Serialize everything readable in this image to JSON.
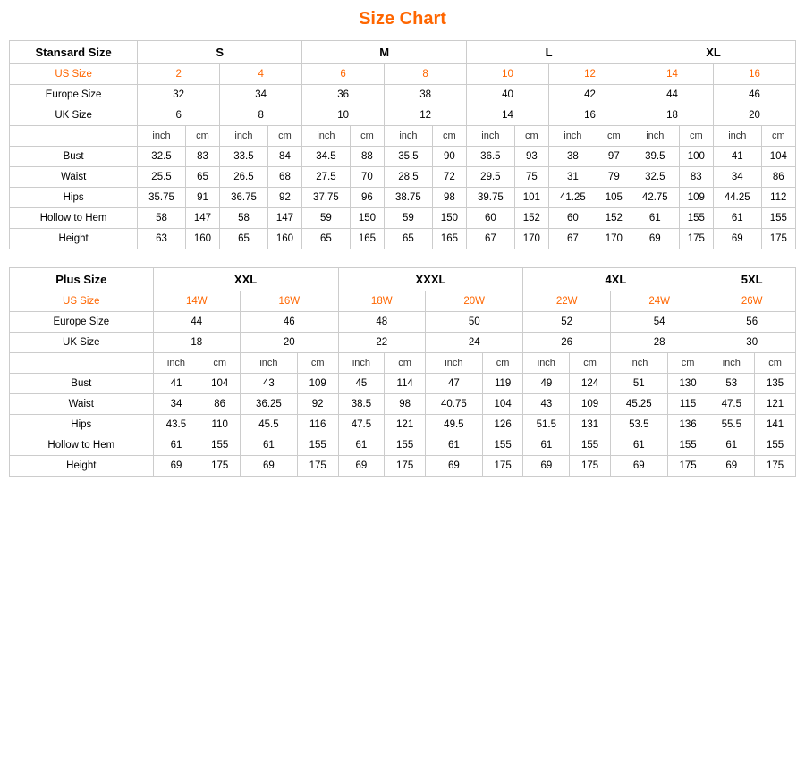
{
  "title": "Size Chart",
  "standard": {
    "headers": {
      "col1": "Stansard Size",
      "s": "S",
      "m": "M",
      "l": "L",
      "xl": "XL"
    },
    "us_size_label": "US Size",
    "us_sizes": [
      "2",
      "4",
      "6",
      "8",
      "10",
      "12",
      "14",
      "16"
    ],
    "europe_size_label": "Europe Size",
    "europe_sizes": [
      "32",
      "34",
      "36",
      "38",
      "40",
      "42",
      "44",
      "46"
    ],
    "uk_size_label": "UK Size",
    "uk_sizes": [
      "6",
      "8",
      "10",
      "12",
      "14",
      "16",
      "18",
      "20"
    ],
    "unit_inch": "inch",
    "unit_cm": "cm",
    "measurements": [
      {
        "label": "Bust",
        "values": [
          "32.5",
          "83",
          "33.5",
          "84",
          "34.5",
          "88",
          "35.5",
          "90",
          "36.5",
          "93",
          "38",
          "97",
          "39.5",
          "100",
          "41",
          "104"
        ]
      },
      {
        "label": "Waist",
        "values": [
          "25.5",
          "65",
          "26.5",
          "68",
          "27.5",
          "70",
          "28.5",
          "72",
          "29.5",
          "75",
          "31",
          "79",
          "32.5",
          "83",
          "34",
          "86"
        ]
      },
      {
        "label": "Hips",
        "values": [
          "35.75",
          "91",
          "36.75",
          "92",
          "37.75",
          "96",
          "38.75",
          "98",
          "39.75",
          "101",
          "41.25",
          "105",
          "42.75",
          "109",
          "44.25",
          "112"
        ]
      },
      {
        "label": "Hollow to Hem",
        "values": [
          "58",
          "147",
          "58",
          "147",
          "59",
          "150",
          "59",
          "150",
          "60",
          "152",
          "60",
          "152",
          "61",
          "155",
          "61",
          "155"
        ]
      },
      {
        "label": "Height",
        "values": [
          "63",
          "160",
          "65",
          "160",
          "65",
          "165",
          "65",
          "165",
          "67",
          "170",
          "67",
          "170",
          "69",
          "175",
          "69",
          "175"
        ]
      }
    ]
  },
  "plus": {
    "headers": {
      "col1": "Plus Size",
      "xxl": "XXL",
      "xxxl": "XXXL",
      "x4l": "4XL",
      "x5l": "5XL"
    },
    "us_size_label": "US Size",
    "us_sizes": [
      "14W",
      "16W",
      "18W",
      "20W",
      "22W",
      "24W",
      "26W"
    ],
    "europe_size_label": "Europe Size",
    "europe_sizes": [
      "44",
      "46",
      "48",
      "50",
      "52",
      "54",
      "56"
    ],
    "uk_size_label": "UK Size",
    "uk_sizes": [
      "18",
      "20",
      "22",
      "24",
      "26",
      "28",
      "30"
    ],
    "unit_inch": "inch",
    "unit_cm": "cm",
    "measurements": [
      {
        "label": "Bust",
        "values": [
          "41",
          "104",
          "43",
          "109",
          "45",
          "114",
          "47",
          "119",
          "49",
          "124",
          "51",
          "130",
          "53",
          "135"
        ]
      },
      {
        "label": "Waist",
        "values": [
          "34",
          "86",
          "36.25",
          "92",
          "38.5",
          "98",
          "40.75",
          "104",
          "43",
          "109",
          "45.25",
          "115",
          "47.5",
          "121"
        ]
      },
      {
        "label": "Hips",
        "values": [
          "43.5",
          "110",
          "45.5",
          "116",
          "47.5",
          "121",
          "49.5",
          "126",
          "51.5",
          "131",
          "53.5",
          "136",
          "55.5",
          "141"
        ]
      },
      {
        "label": "Hollow to Hem",
        "values": [
          "61",
          "155",
          "61",
          "155",
          "61",
          "155",
          "61",
          "155",
          "61",
          "155",
          "61",
          "155",
          "61",
          "155"
        ]
      },
      {
        "label": "Height",
        "values": [
          "69",
          "175",
          "69",
          "175",
          "69",
          "175",
          "69",
          "175",
          "69",
          "175",
          "69",
          "175",
          "69",
          "175"
        ]
      }
    ]
  }
}
